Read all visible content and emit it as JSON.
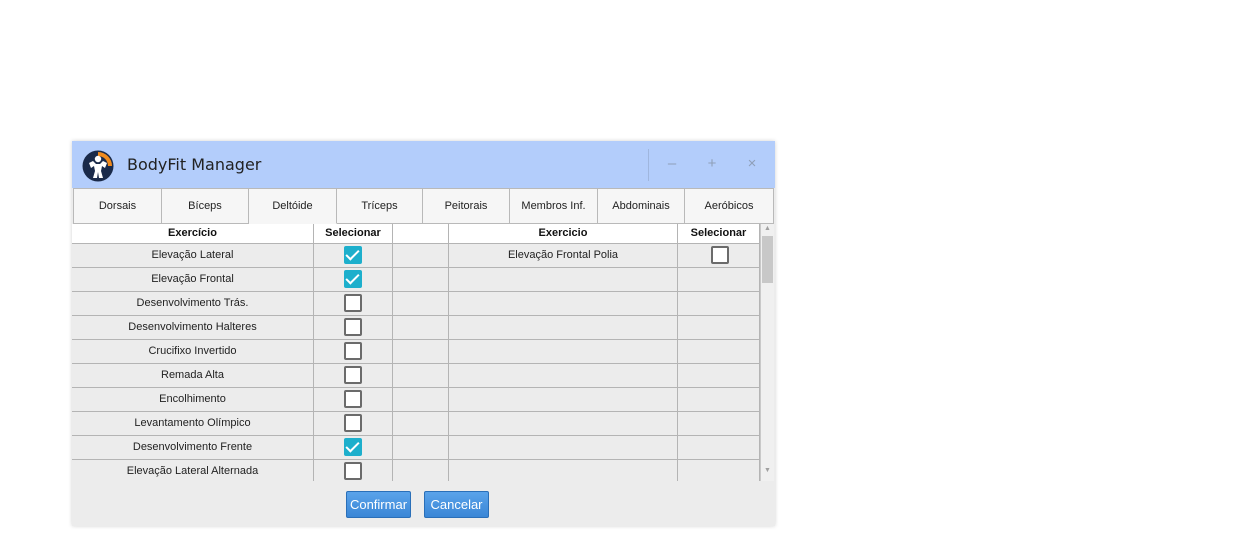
{
  "window": {
    "title": "BodyFit Manager",
    "minimize": "–",
    "maximize": "+",
    "close": "×"
  },
  "tabs": [
    "Dorsais",
    "Bíceps",
    "Deltóide",
    "Tríceps",
    "Peitorais",
    "Membros Inf.",
    "Abdominais",
    "Aeróbicos"
  ],
  "active_tab": "Deltóide",
  "table": {
    "left_header_exercise": "Exercício",
    "left_header_select": "Selecionar",
    "right_header_exercise": "Exercicio",
    "right_header_select": "Selecionar",
    "left_rows": [
      {
        "name": "Elevação Lateral",
        "checked": true
      },
      {
        "name": "Elevação Frontal",
        "checked": true
      },
      {
        "name": "Desenvolvimento Trás.",
        "checked": false
      },
      {
        "name": "Desenvolvimento Halteres",
        "checked": false
      },
      {
        "name": "Crucifixo Invertido",
        "checked": false
      },
      {
        "name": "Remada Alta",
        "checked": false
      },
      {
        "name": "Encolhimento",
        "checked": false
      },
      {
        "name": "Levantamento Olímpico",
        "checked": false
      },
      {
        "name": "Desenvolvimento Frente",
        "checked": true
      },
      {
        "name": "Elevação Lateral Alternada",
        "checked": false
      }
    ],
    "right_rows": [
      {
        "name": "Elevação Frontal Polia",
        "checked": false
      }
    ]
  },
  "buttons": {
    "confirm": "Confirmar",
    "cancel": "Cancelar"
  },
  "colors": {
    "titlebar": "#b3cdfb",
    "checkbox_checked": "#1dafcc",
    "button": "#3a86d6"
  }
}
